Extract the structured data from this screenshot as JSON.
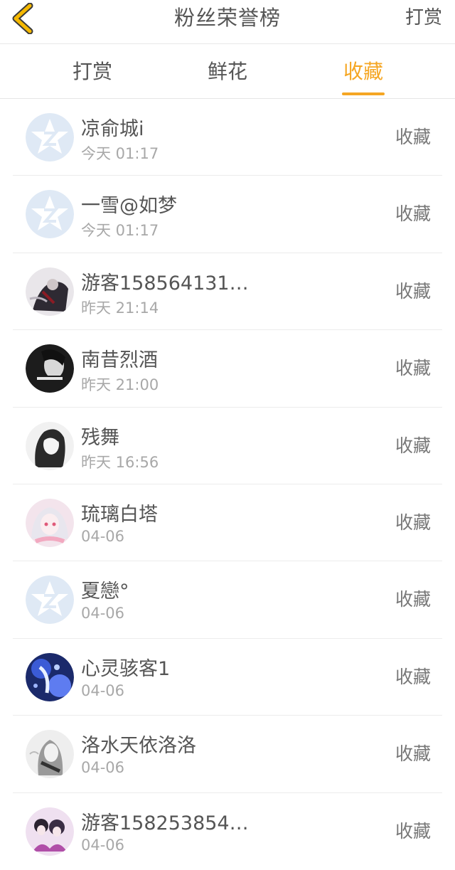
{
  "header": {
    "title": "粉丝荣誉榜",
    "right_link": "打赏",
    "back_icon": "chevron-left-icon",
    "accent_color": "#f5a623"
  },
  "tabs": [
    {
      "label": "打赏",
      "active": false
    },
    {
      "label": "鲜花",
      "active": false
    },
    {
      "label": "收藏",
      "active": true
    }
  ],
  "fans": [
    {
      "name": "凉俞城i",
      "time": "今天 01:17",
      "action": "收藏",
      "avatar": "default-qq-avatar"
    },
    {
      "name": "一雪@如梦",
      "time": "今天 01:17",
      "action": "收藏",
      "avatar": "default-qq-avatar"
    },
    {
      "name": "游客158564131…",
      "time": "昨天 21:14",
      "action": "收藏",
      "avatar": "dark-figure-avatar"
    },
    {
      "name": "南昔烈酒",
      "time": "昨天 21:00",
      "action": "收藏",
      "avatar": "black-white-avatar"
    },
    {
      "name": "残舞",
      "time": "昨天 16:56",
      "action": "收藏",
      "avatar": "sketch-girl-avatar"
    },
    {
      "name": "琉璃白塔",
      "time": "04-06",
      "action": "收藏",
      "avatar": "pink-anime-avatar"
    },
    {
      "name": "夏戀°",
      "time": "04-06",
      "action": "收藏",
      "avatar": "default-qq-avatar"
    },
    {
      "name": "心灵骇客1",
      "time": "04-06",
      "action": "收藏",
      "avatar": "blue-anime-avatar"
    },
    {
      "name": "洛水天依洛洛",
      "time": "04-06",
      "action": "收藏",
      "avatar": "grey-anime-avatar"
    },
    {
      "name": "游客158253854…",
      "time": "04-06",
      "action": "收藏",
      "avatar": "purple-anime-avatar"
    }
  ]
}
